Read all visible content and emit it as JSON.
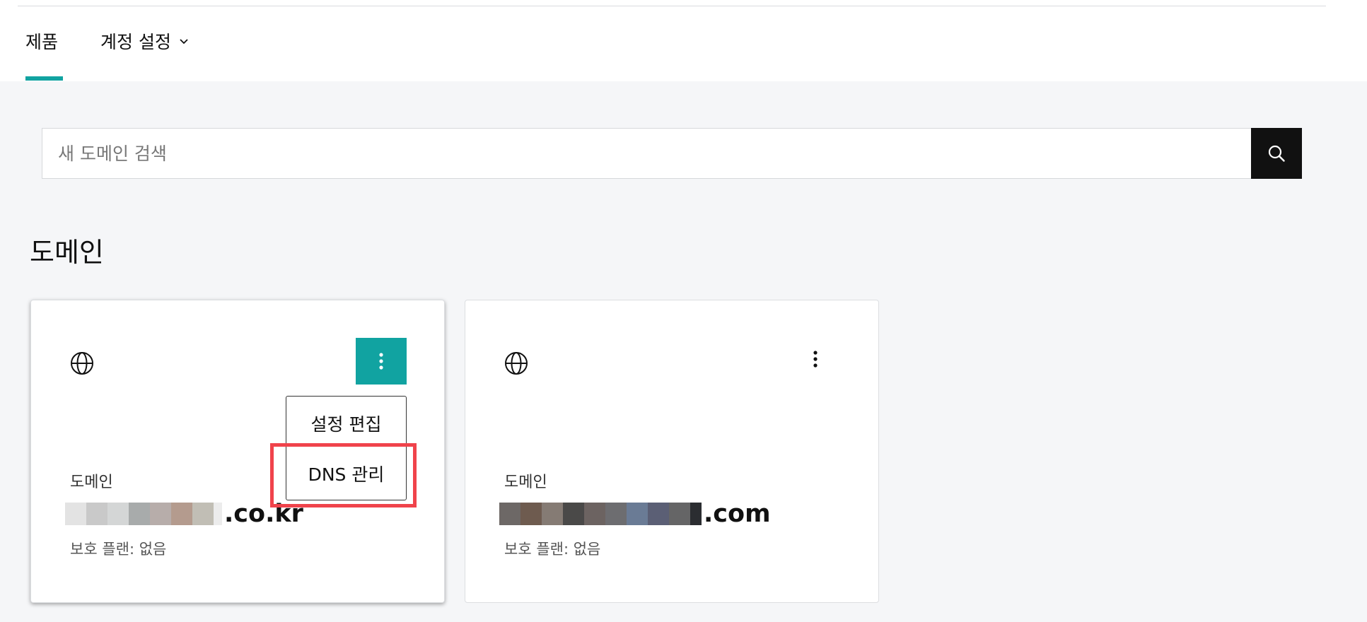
{
  "nav": {
    "tabs": [
      {
        "label": "제품",
        "active": true
      },
      {
        "label": "계정 설정",
        "has_dropdown": true
      }
    ],
    "accent_color": "#11a3a1"
  },
  "search": {
    "placeholder": "새 도메인 검색",
    "icon": "search-icon"
  },
  "section": {
    "title": "도메인"
  },
  "domains": [
    {
      "icon": "globe-icon",
      "label": "도메인",
      "name_suffix": ".co.kr",
      "name_prefix_obscured": true,
      "plan": "보호 플랜: 없음",
      "menu_open": true,
      "menu_items": [
        "설정 편집",
        "DNS 관리"
      ],
      "highlighted_item": "DNS 관리"
    },
    {
      "icon": "globe-icon",
      "label": "도메인",
      "name_suffix": ".com",
      "name_prefix_obscured": true,
      "plan": "보호 플랜: 없음",
      "menu_open": false
    }
  ],
  "highlight_color": "#f0434b"
}
